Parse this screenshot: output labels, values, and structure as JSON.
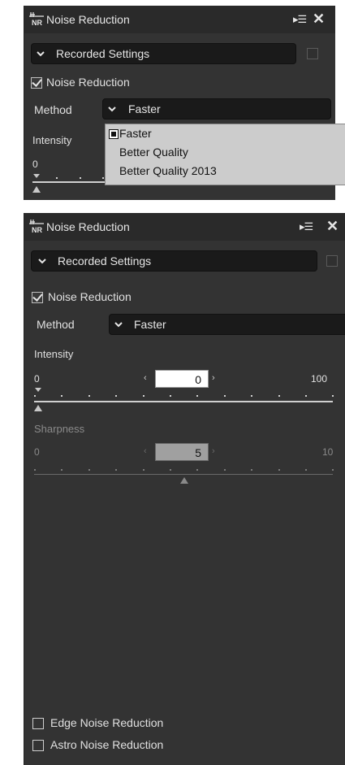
{
  "top_panel": {
    "title": "Noise Reduction",
    "preset_dropdown": "Recorded Settings",
    "noise_reduction_label": "Noise Reduction",
    "method_label": "Method",
    "method_value": "Faster",
    "intensity_label": "Intensity",
    "intensity_min": "0",
    "method_options": [
      "Faster",
      "Better Quality",
      "Better Quality 2013"
    ],
    "selected_option": "Faster"
  },
  "main_panel": {
    "title": "Noise Reduction",
    "preset_dropdown": "Recorded Settings",
    "noise_reduction_label": "Noise Reduction",
    "noise_reduction_checked": true,
    "method_label": "Method",
    "method_value": "Faster",
    "intensity": {
      "label": "Intensity",
      "min": "0",
      "max": "100",
      "value": "0"
    },
    "sharpness": {
      "label": "Sharpness",
      "min": "0",
      "max": "10",
      "value": "5",
      "enabled": false
    },
    "edge_noise_label": "Edge Noise Reduction",
    "astro_noise_label": "Astro Noise Reduction"
  },
  "icons": {
    "nr_icon": "nr-icon",
    "menu_icon": "menu-icon",
    "close_icon": "close-icon",
    "chevron": "chevron-down-icon"
  }
}
